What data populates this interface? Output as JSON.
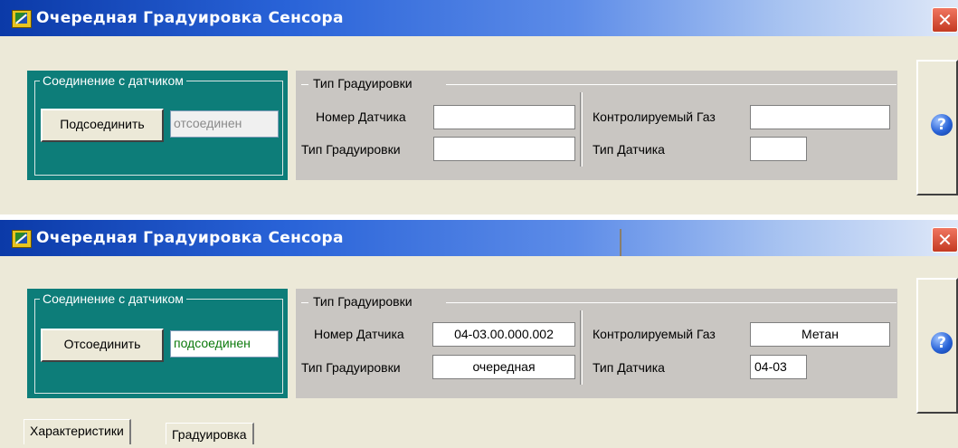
{
  "windows": [
    {
      "title": "Очередная Градуировка Сенсора",
      "close_label": "✕",
      "connection": {
        "legend": "Соединение с датчиком",
        "button_label": "Подсоединить",
        "status": "отсоединен"
      },
      "calibration": {
        "legend": "Тип Градуировки",
        "sensor_number_label": "Номер Датчика",
        "sensor_number_value": "",
        "calibration_type_label": "Тип Градуировки",
        "calibration_type_value": "",
        "gas_label": "Контролируемый Газ",
        "gas_value": "",
        "sensor_type_label": "Тип Датчика",
        "sensor_type_value": ""
      },
      "help_label": "?"
    },
    {
      "title": "Очередная Градуировка Сенсора",
      "close_label": "✕",
      "connection": {
        "legend": "Соединение с датчиком",
        "button_label": "Отсоединить",
        "status": "подсоединен"
      },
      "calibration": {
        "legend": "Тип Градуировки",
        "sensor_number_label": "Номер Датчика",
        "sensor_number_value": "04-03.00.000.002",
        "calibration_type_label": "Тип Градуировки",
        "calibration_type_value": "очередная",
        "gas_label": "Контролируемый Газ",
        "gas_value": "Метан",
        "sensor_type_label": "Тип Датчика",
        "sensor_type_value": "04-03"
      },
      "help_label": "?",
      "tabs": [
        "Характеристики",
        "Градуировка"
      ]
    }
  ],
  "colors": {
    "title_gradient_start": "#0b3aa8",
    "connection_panel": "#0d7d79",
    "calibration_panel": "#c9c6c2",
    "window_bg": "#ece9d8",
    "status_connected": "#0c7a0c",
    "status_disconnected": "#8a8a8a"
  }
}
